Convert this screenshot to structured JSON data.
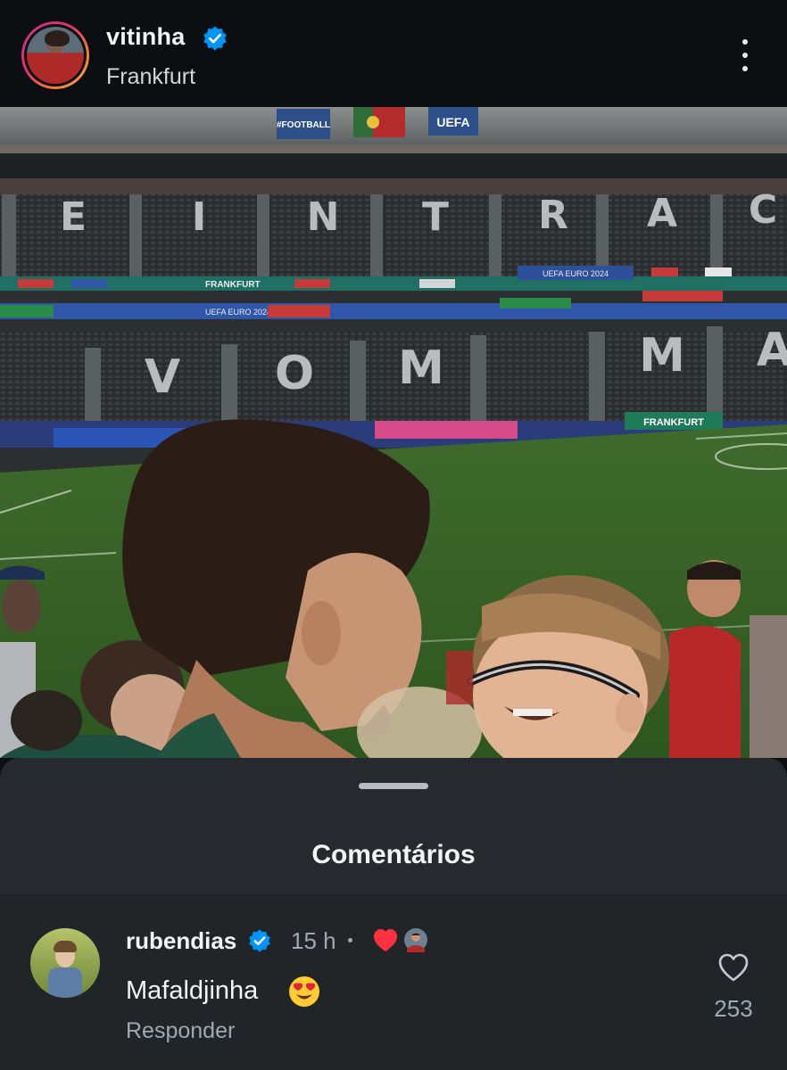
{
  "header": {
    "username": "vitinha",
    "verified": true,
    "location": "Frankfurt",
    "more_icon": "more-vertical-icon"
  },
  "photo": {
    "signage": {
      "banner_left": "#FOOTBALL",
      "banner_right": "UEFA",
      "ad_board_1": "FRANKFURT",
      "ad_board_2": "UEFA EURO 2024",
      "ad_board_3": "UEFA EURO 2024",
      "pitch_board": "FRANKFURT",
      "upper_tier_letters": "EINTRACHT",
      "lower_tier_letters": "VOM MAIN"
    }
  },
  "comments_sheet": {
    "title": "Comentários",
    "comments": [
      {
        "username": "rubendias",
        "verified": true,
        "time": "15 h",
        "liked_by_author": true,
        "text": "Mafaldjinha",
        "emoji": "heart-eyes-emoji",
        "reply_label": "Responder",
        "like_icon": "heart-outline-icon",
        "like_count": "253"
      }
    ]
  },
  "colors": {
    "background": "#0c0f12",
    "sheet": "#262a2e",
    "verified": "#0095f6",
    "like_red": "#ff3040",
    "muted_text": "#a2a8ae"
  }
}
